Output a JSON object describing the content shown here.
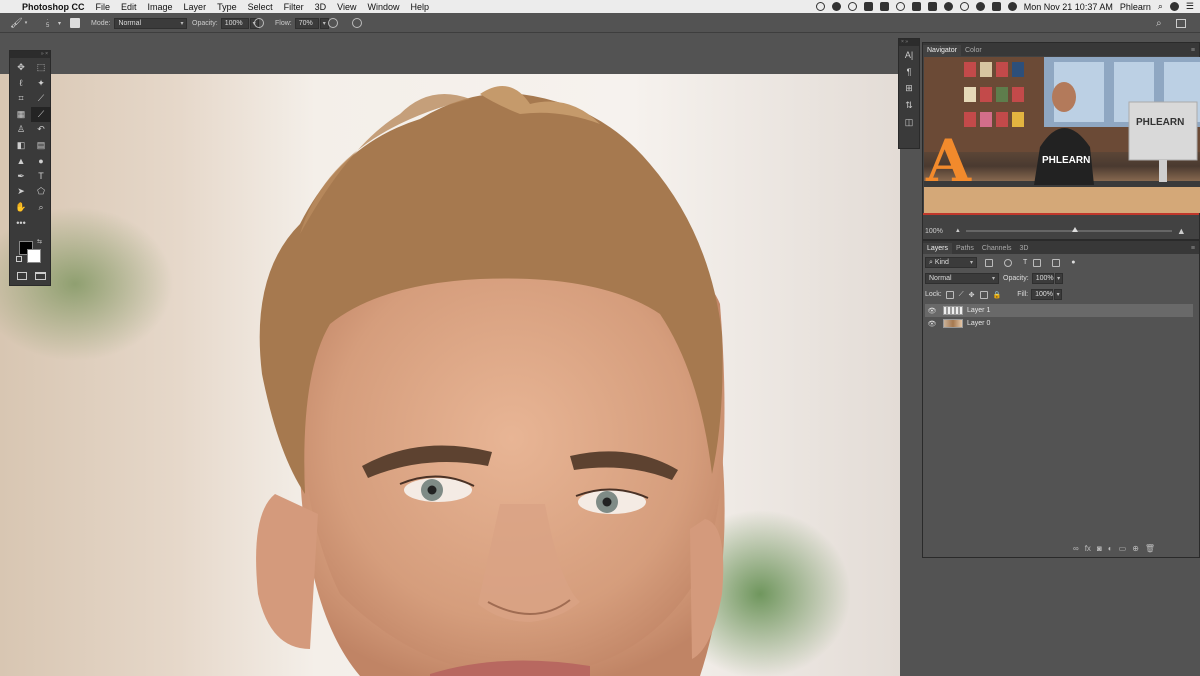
{
  "menubar": {
    "apple_glyph": "",
    "app_name": "Photoshop CC",
    "menus": [
      "File",
      "Edit",
      "Image",
      "Layer",
      "Type",
      "Select",
      "Filter",
      "3D",
      "View",
      "Window",
      "Help"
    ],
    "datetime": "Mon Nov 21  10:37 AM",
    "user": "Phlearn"
  },
  "options_bar": {
    "brush_size": "5",
    "mode_label": "Mode:",
    "mode_value": "Normal",
    "opacity_label": "Opacity:",
    "opacity_value": "100%",
    "flow_label": "Flow:",
    "flow_value": "70%"
  },
  "navigator": {
    "tabs": [
      "Navigator",
      "Color"
    ],
    "zoom": "100%",
    "thumbnail_text": "PHLEARN",
    "shirt_text": "PHLEARN",
    "letter": "A"
  },
  "layers": {
    "tabs": [
      "Layers",
      "Paths",
      "Channels",
      "3D"
    ],
    "kind_label": "Kind",
    "blend_mode": "Normal",
    "opacity_label": "Opacity:",
    "opacity_value": "100%",
    "lock_label": "Lock:",
    "fill_label": "Fill:",
    "fill_value": "100%",
    "items": [
      {
        "name": "Layer 1",
        "selected": true
      },
      {
        "name": "Layer 0",
        "selected": false
      }
    ]
  },
  "colors": {
    "accent": "#c0372b",
    "panel": "#535353",
    "menubar": "#ececec"
  }
}
